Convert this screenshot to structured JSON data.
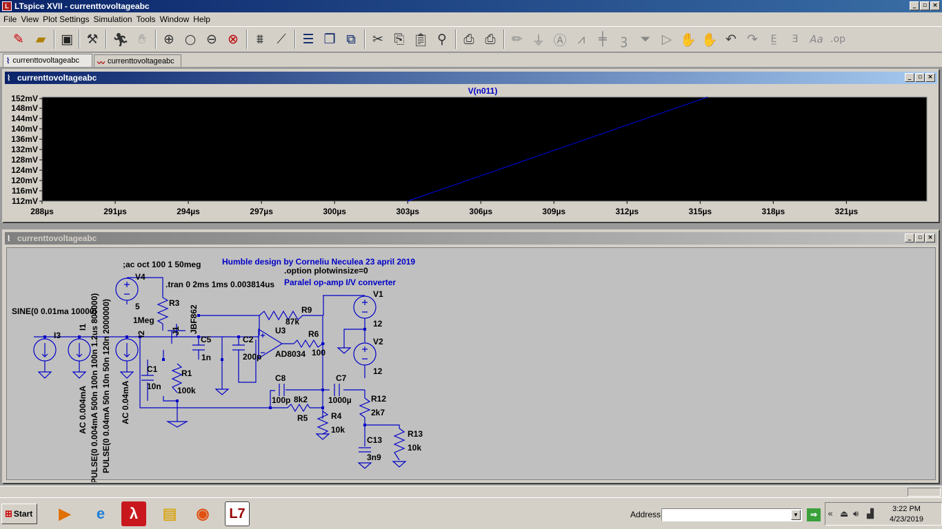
{
  "window": {
    "title": "LTspice XVII - currenttovoltageabc",
    "controls": [
      "_",
      "▫",
      "×"
    ]
  },
  "menu": [
    "File",
    "View",
    "Plot Settings",
    "Simulation",
    "Tools",
    "Window",
    "Help"
  ],
  "toolbar_icons": [
    "new-schematic-icon",
    "open-icon",
    "save-icon",
    "control-panel-icon",
    "run-icon",
    "halt-icon",
    "zoom-in-icon",
    "zoom-out-icon",
    "zoom-fit-icon",
    "zoom-cancel-icon",
    "autorange-icon",
    "measure-icon",
    "tile-horizontal-icon",
    "cascade-icon",
    "tile-vertical-icon",
    "cut-icon",
    "copy-icon",
    "paste-icon",
    "find-icon",
    "print-preview-icon",
    "print-icon",
    "draw-wire-icon",
    "ground-icon",
    "label-net-icon",
    "resistor-icon",
    "capacitor-icon",
    "inductor-icon",
    "diode-icon",
    "component-icon",
    "move-icon",
    "drag-icon",
    "undo-icon",
    "redo-icon",
    "rotate-icon",
    "mirror-icon",
    "text-icon",
    "spice-directive-icon"
  ],
  "tabs": [
    {
      "label": "currenttovoltageabc",
      "kind": "schematic"
    },
    {
      "label": "currenttovoltageabc",
      "kind": "waveform"
    }
  ],
  "plot_window": {
    "title": "currenttovoltageabc"
  },
  "schematic_window": {
    "title": "currenttovoltageabc"
  },
  "chart_data": {
    "type": "line",
    "title": "V(n011)",
    "background": "#000000",
    "series": [
      {
        "name": "V(n011)",
        "color": "#0000c8",
        "x": [
          303,
          315.3
        ],
        "y": [
          112,
          152.3
        ]
      }
    ],
    "xlim": [
      288,
      324.3
    ],
    "ylim": [
      112,
      152.3
    ],
    "x_ticks": [
      288,
      291,
      294,
      297,
      300,
      303,
      306,
      309,
      312,
      315,
      318,
      321
    ],
    "x_tick_labels": [
      "288µs",
      "291µs",
      "294µs",
      "297µs",
      "300µs",
      "303µs",
      "306µs",
      "309µs",
      "312µs",
      "315µs",
      "318µs",
      "321µs"
    ],
    "y_ticks": [
      152,
      148,
      144,
      140,
      136,
      132,
      128,
      124,
      120,
      116,
      112
    ],
    "y_tick_labels": [
      "152mV",
      "148mV",
      "144mV",
      "140mV",
      "136mV",
      "132mV",
      "128mV",
      "124mV",
      "120mV",
      "116mV",
      "112mV"
    ]
  },
  "schematic": {
    "directives": {
      "ac": ";ac oct 100 1 50meg",
      "tran": ".tran 0 2ms 1ms 0.003814us",
      "option": ".option plotwinsize=0"
    },
    "comments": {
      "credit": "Humble design by Corneliu Neculea 23 april 2019",
      "subtitle": "Paralel op-amp I/V converter"
    },
    "labels": {
      "v4": "V4",
      "v4_val": "5",
      "r3": "R3",
      "r3_val": "1Meg",
      "j1": "J1",
      "j1_model": "JBF862",
      "sine": "SINE(0 0.01ma 10000)",
      "i3": "I3",
      "i1": "I1",
      "i2": "I2",
      "i1_ac": "AC 0.004mA",
      "i1_pulse": "PULSE(0 0.004mA 500n 100n 100n 1.2us 800000)",
      "i2_pulse": "PULSE(0 0.04mA 50n 10n 50n 120n 2000000)",
      "i2_ac": "AC 0.04mA",
      "c5": "C5",
      "c5_val": "1n",
      "c2": "C2",
      "c2_val": "200p",
      "c1": "C1",
      "c1_val": "10n",
      "r1": "R1",
      "r1_val": "100k",
      "r9": "R9",
      "r9_val": "87k",
      "u3": "U3",
      "u3_model": "AD8034",
      "r6": "R6",
      "r6_val": "100",
      "v1": "V1",
      "v1_val": "12",
      "v2": "V2",
      "v2_val": "12",
      "c8": "C8",
      "c8_val": "100p",
      "c7": "C7",
      "c7_val": "1000µ",
      "r5": "R5",
      "r5_val": "8k2",
      "r4": "R4",
      "r4_val": "10k",
      "r12": "R12",
      "r12_val": "2k7",
      "c13": "C13",
      "c13_val": "3n9",
      "r13": "R13",
      "r13_val": "10k"
    }
  },
  "taskbar": {
    "start_label": "Start",
    "address_label": "Address",
    "address_value": "",
    "time": "3:22 PM",
    "date": "4/23/2019"
  }
}
